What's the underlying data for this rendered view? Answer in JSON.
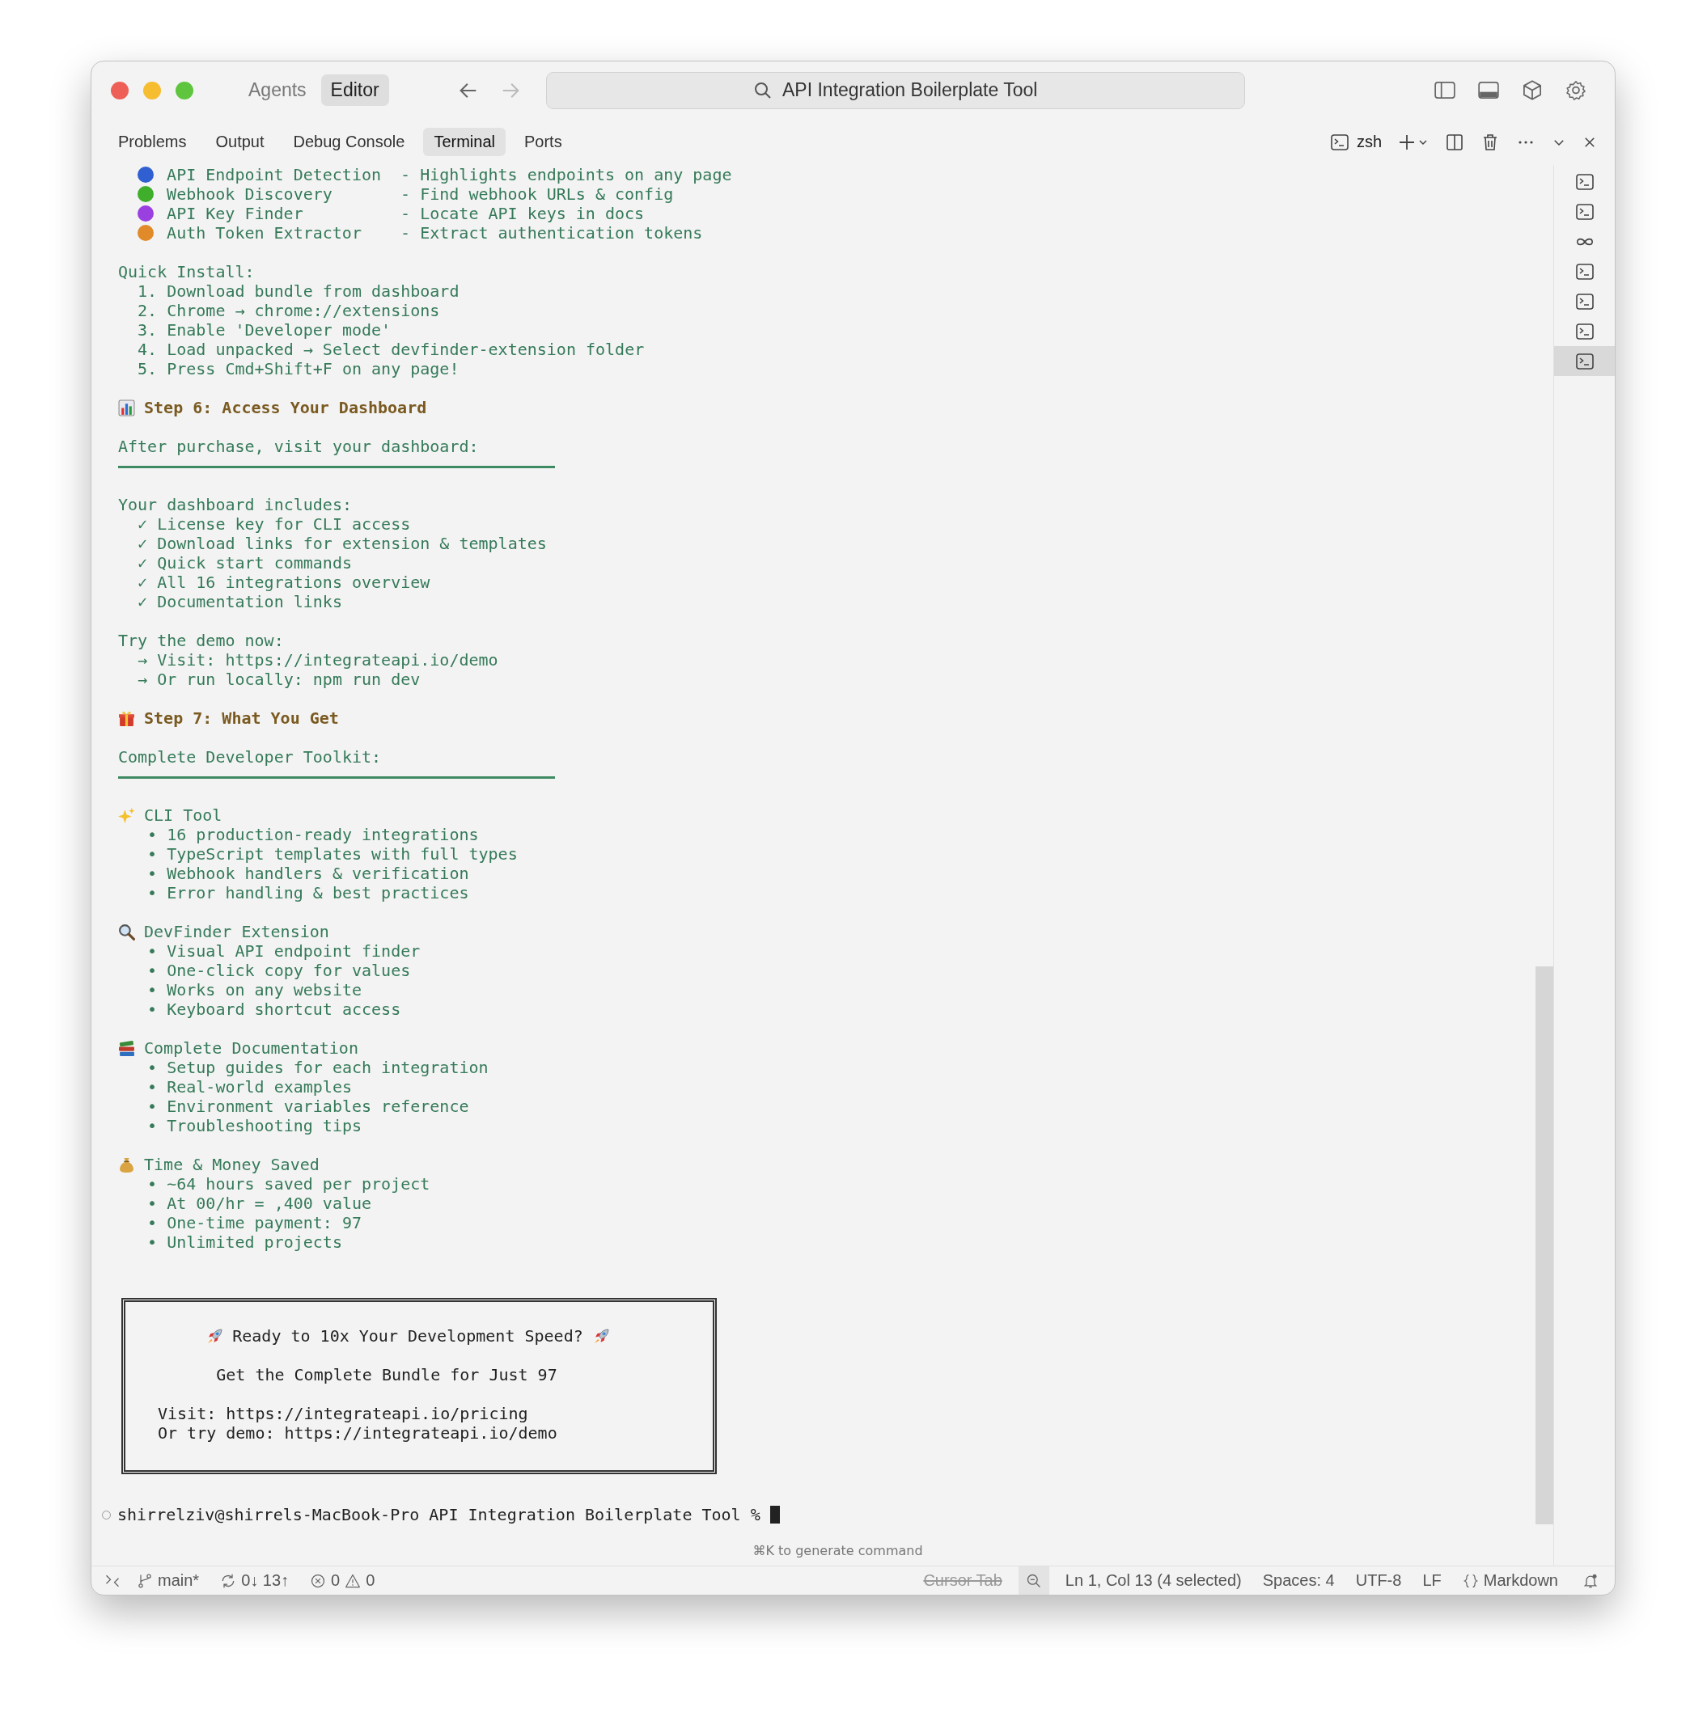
{
  "titlebar": {
    "modes": [
      {
        "label": "Agents",
        "selected": false
      },
      {
        "label": "Editor",
        "selected": true
      }
    ],
    "command_center": {
      "title": "API Integration Boilerplate Tool"
    }
  },
  "panel": {
    "tabs": [
      {
        "label": "Problems",
        "selected": false
      },
      {
        "label": "Output",
        "selected": false
      },
      {
        "label": "Debug Console",
        "selected": false
      },
      {
        "label": "Terminal",
        "selected": true
      },
      {
        "label": "Ports",
        "selected": false
      }
    ],
    "shell": "zsh"
  },
  "terminal": {
    "lines": [
      {
        "kind": "feature",
        "color": "#2f5fd0",
        "name": "API Endpoint Detection",
        "desc": "- Highlights endpoints on any page"
      },
      {
        "kind": "feature",
        "color": "#3fae2a",
        "name": "Webhook Discovery",
        "desc": "- Find webhook URLs & config"
      },
      {
        "kind": "feature",
        "color": "#9a3fe0",
        "name": "API Key Finder",
        "desc": "- Locate API keys in docs"
      },
      {
        "kind": "feature",
        "color": "#e08a2a",
        "name": "Auth Token Extractor",
        "desc": "- Extract authentication tokens"
      },
      {
        "kind": "blank"
      },
      {
        "kind": "text",
        "text": "Quick Install:"
      },
      {
        "kind": "text",
        "text": "  1. Download bundle from dashboard"
      },
      {
        "kind": "text",
        "text": "  2. Chrome → chrome://extensions"
      },
      {
        "kind": "text",
        "text": "  3. Enable 'Developer mode'"
      },
      {
        "kind": "text",
        "text": "  4. Load unpacked → Select devfinder-extension folder"
      },
      {
        "kind": "text",
        "text": "  5. Press Cmd+Shift+F on any page!"
      },
      {
        "kind": "blank"
      },
      {
        "kind": "heading",
        "text": "Step 6: Access Your Dashboard"
      },
      {
        "kind": "blank"
      },
      {
        "kind": "text",
        "text": "After purchase, visit your dashboard:"
      },
      {
        "kind": "rule"
      },
      {
        "kind": "blank"
      },
      {
        "kind": "text",
        "text": "Your dashboard includes:"
      },
      {
        "kind": "text",
        "text": "  ✓ License key for CLI access"
      },
      {
        "kind": "text",
        "text": "  ✓ Download links for extension & templates"
      },
      {
        "kind": "text",
        "text": "  ✓ Quick start commands"
      },
      {
        "kind": "text",
        "text": "  ✓ All 16 integrations overview"
      },
      {
        "kind": "text",
        "text": "  ✓ Documentation links"
      },
      {
        "kind": "blank"
      },
      {
        "kind": "text",
        "text": "Try the demo now:"
      },
      {
        "kind": "text",
        "text": "  → Visit: https://integrateapi.io/demo"
      },
      {
        "kind": "text",
        "text": "  → Or run locally: npm run dev"
      },
      {
        "kind": "blank"
      },
      {
        "kind": "heading",
        "text": "Step 7: What You Get"
      },
      {
        "kind": "blank"
      },
      {
        "kind": "text",
        "text": "Complete Developer Toolkit:"
      },
      {
        "kind": "rule"
      },
      {
        "kind": "blank"
      },
      {
        "kind": "section",
        "text": "CLI Tool"
      },
      {
        "kind": "text",
        "text": "   • 16 production-ready integrations"
      },
      {
        "kind": "text",
        "text": "   • TypeScript templates with full types"
      },
      {
        "kind": "text",
        "text": "   • Webhook handlers & verification"
      },
      {
        "kind": "text",
        "text": "   • Error handling & best practices"
      },
      {
        "kind": "blank"
      },
      {
        "kind": "section",
        "text": "DevFinder Extension"
      },
      {
        "kind": "text",
        "text": "   • Visual API endpoint finder"
      },
      {
        "kind": "text",
        "text": "   • One-click copy for values"
      },
      {
        "kind": "text",
        "text": "   • Works on any website"
      },
      {
        "kind": "text",
        "text": "   • Keyboard shortcut access"
      },
      {
        "kind": "blank"
      },
      {
        "kind": "section",
        "text": "Complete Documentation"
      },
      {
        "kind": "text",
        "text": "   • Setup guides for each integration"
      },
      {
        "kind": "text",
        "text": "   • Real-world examples"
      },
      {
        "kind": "text",
        "text": "   • Environment variables reference"
      },
      {
        "kind": "text",
        "text": "   • Troubleshooting tips"
      },
      {
        "kind": "blank"
      },
      {
        "kind": "section",
        "text": "Time & Money Saved"
      },
      {
        "kind": "text",
        "text": "   • ~64 hours saved per project"
      },
      {
        "kind": "text",
        "text": "   • At 00/hr = ,400 value"
      },
      {
        "kind": "text",
        "text": "   • One-time payment: 97"
      },
      {
        "kind": "text",
        "text": "   • Unlimited projects"
      },
      {
        "kind": "blank"
      },
      {
        "kind": "blank"
      }
    ],
    "box": {
      "headline": "Ready to 10x Your Development Speed?",
      "offer": "Get the Complete Bundle for Just 97",
      "links": [
        "Visit: https://integrateapi.io/pricing",
        "Or try demo: https://integrateapi.io/demo"
      ]
    },
    "prompt": "shirrelziv@shirrels-MacBook-Pro API Integration Boilerplate Tool %",
    "hint": "⌘K to generate command"
  },
  "side_tabs": [
    {
      "kind": "terminal",
      "selected": false
    },
    {
      "kind": "terminal",
      "selected": false
    },
    {
      "kind": "infinity",
      "selected": false
    },
    {
      "kind": "terminal",
      "selected": false
    },
    {
      "kind": "terminal",
      "selected": false
    },
    {
      "kind": "terminal",
      "selected": false
    },
    {
      "kind": "terminal",
      "selected": true
    }
  ],
  "status_bar": {
    "branch": "main*",
    "sync": "0↓ 13↑",
    "errors": "0",
    "warnings": "0",
    "cursor_tab": {
      "label": "Cursor Tab",
      "disabled": true
    },
    "position": "Ln 1, Col 13 (4 selected)",
    "spaces": "Spaces: 4",
    "encoding": "UTF-8",
    "eol": "LF",
    "language": "Markdown"
  }
}
